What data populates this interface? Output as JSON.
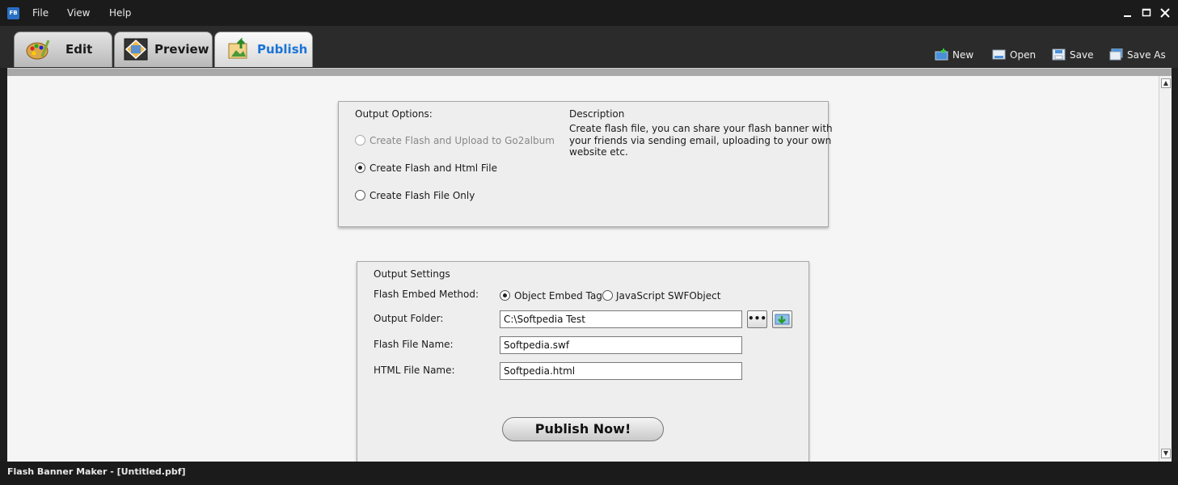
{
  "app": {
    "icon_text": "FB",
    "menu": [
      "File",
      "View",
      "Help"
    ]
  },
  "tabs": [
    {
      "label": "Edit",
      "icon": "palette-icon"
    },
    {
      "label": "Preview",
      "icon": "preview-icon"
    },
    {
      "label": "Publish",
      "icon": "publish-icon",
      "active": true
    }
  ],
  "toolbar_actions": [
    {
      "label": "New",
      "icon": "new-folder-icon"
    },
    {
      "label": "Open",
      "icon": "open-icon"
    },
    {
      "label": "Save",
      "icon": "save-icon"
    },
    {
      "label": "Save As",
      "icon": "save-as-icon"
    }
  ],
  "output_options": {
    "title": "Output Options:",
    "options": [
      {
        "label": "Create Flash and Upload to Go2album",
        "checked": false,
        "disabled": true
      },
      {
        "label": "Create Flash and Html File",
        "checked": true,
        "disabled": false
      },
      {
        "label": "Create Flash File Only",
        "checked": false,
        "disabled": false
      }
    ],
    "description_title": "Description",
    "description_lines": [
      "Create flash file, you can share your flash banner with",
      "your friends via sending email, uploading to your own",
      "website etc."
    ]
  },
  "output_settings": {
    "title": "Output Settings",
    "embed_method_label": "Flash Embed Method:",
    "embed_options": [
      {
        "label": "Object Embed Tag",
        "checked": true
      },
      {
        "label": "JavaScript SWFObject",
        "checked": false
      }
    ],
    "output_folder_label": "Output Folder:",
    "output_folder_value": "C:\\Softpedia Test",
    "browse_label": "•••",
    "flash_file_label": "Flash File Name:",
    "flash_file_value": "Softpedia.swf",
    "html_file_label": "HTML File Name:",
    "html_file_value": "Softpedia.html",
    "publish_label": "Publish Now!"
  },
  "status": {
    "text": "Flash Banner Maker - [Untitled.pbf]"
  },
  "colors": {
    "active_tab_text": "#1b73d6",
    "chrome_dark": "#1b1b1b",
    "toolbar": "#2b2b2b"
  }
}
